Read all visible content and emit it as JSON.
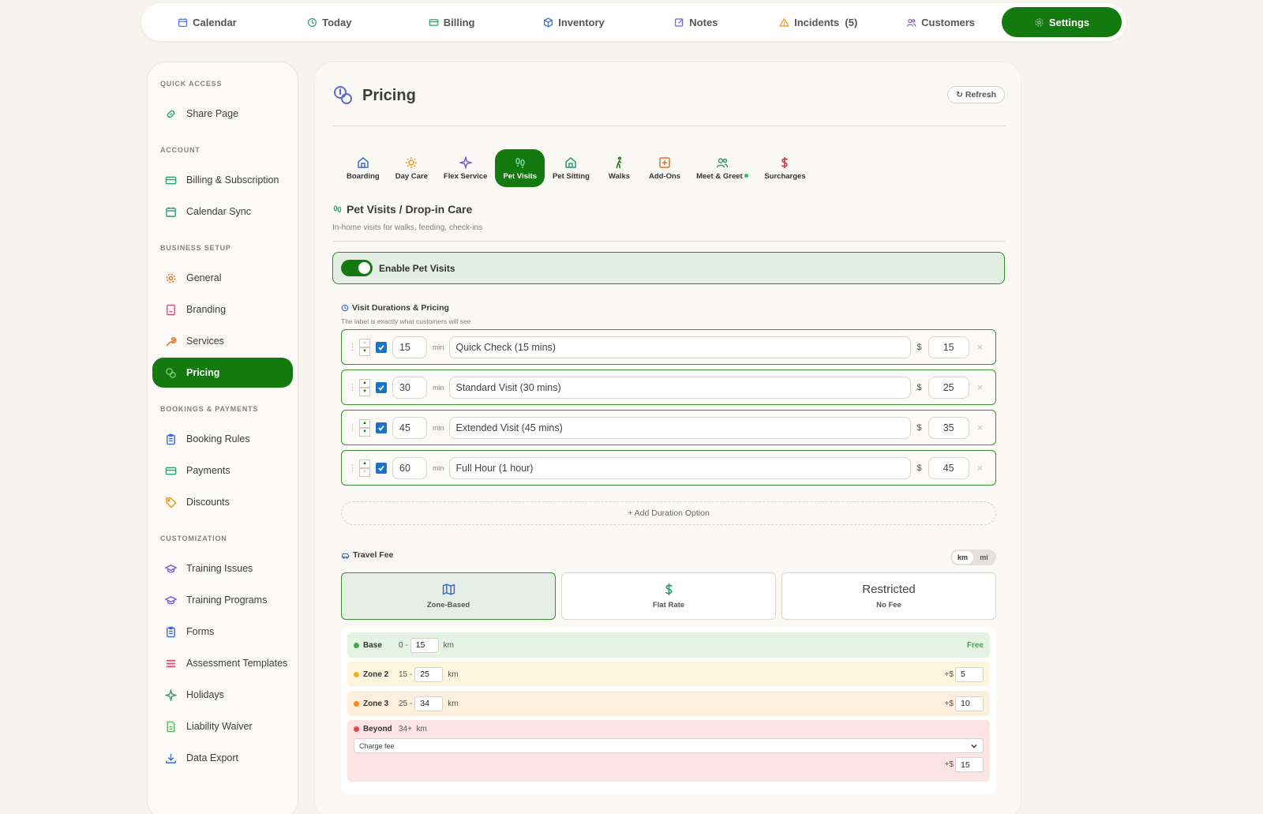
{
  "colors": {
    "accent": "#147a0f",
    "background": "#f7f3ee"
  },
  "topnav": [
    {
      "label": "Calendar",
      "icon": "calendar-icon",
      "color": "#4a7bd6"
    },
    {
      "label": "Today",
      "icon": "clock-icon",
      "color": "#2e9e6a"
    },
    {
      "label": "Billing",
      "icon": "credit-card-icon",
      "color": "#2e9e6a"
    },
    {
      "label": "Inventory",
      "icon": "box-icon",
      "color": "#3b6ad0"
    },
    {
      "label": "Notes",
      "icon": "edit-icon",
      "color": "#7b5bd0"
    },
    {
      "label": "Incidents  (5)",
      "icon": "warning-icon",
      "color": "#e89a1c"
    },
    {
      "label": "Customers",
      "icon": "users-icon",
      "color": "#8a62c9"
    },
    {
      "label": "Settings",
      "icon": "gear-icon",
      "color": "#ffffff",
      "active": true
    }
  ],
  "sidebar": {
    "quick_access": "QUICK ACCESS",
    "share_page": "Share Page",
    "account": "ACCOUNT",
    "billing_subscription": "Billing & Subscription",
    "calendar_sync": "Calendar Sync",
    "business_setup": "BUSINESS SETUP",
    "general": "General",
    "branding": "Branding",
    "services": "Services",
    "pricing": "Pricing",
    "bookings_payments": "BOOKINGS & PAYMENTS",
    "booking_rules": "Booking Rules",
    "payments": "Payments",
    "discounts": "Discounts",
    "customization": "CUSTOMIZATION",
    "training_issues": "Training Issues",
    "training_programs": "Training Programs",
    "forms": "Forms",
    "assessment_templates": "Assessment Templates",
    "holidays": "Holidays",
    "liability_waiver": "Liability Waiver",
    "data_export": "Data Export"
  },
  "main": {
    "title": "Pricing",
    "refresh_label": "↻ Refresh",
    "tabs": {
      "boarding": "Boarding",
      "day_care": "Day Care",
      "flex_service": "Flex Service",
      "pet_visits": "Pet Visits",
      "pet_sitting": "Pet Sitting",
      "walks": "Walks",
      "add_ons": "Add-Ons",
      "meet_greet": "Meet & Greet",
      "surcharges": "Surcharges"
    },
    "section_title": "Pet Visits / Drop-in Care",
    "section_subtitle": "In-home visits for walks, feeding, check-ins",
    "enable_label": "Enable Pet Visits",
    "durations_title": "Visit Durations & Pricing",
    "durations_note": "The label is exactly what customers will see",
    "min_unit": "min",
    "currency": "$",
    "durations": [
      {
        "minutes": "15",
        "label": "Quick Check (15 mins)",
        "price": "15"
      },
      {
        "minutes": "30",
        "label": "Standard Visit (30 mins)",
        "price": "25"
      },
      {
        "minutes": "45",
        "label": "Extended Visit (45 mins)",
        "price": "35"
      },
      {
        "minutes": "60",
        "label": "Full Hour (1 hour)",
        "price": "45"
      }
    ],
    "add_duration": "+ Add Duration Option",
    "travel_fee_title": "Travel Fee",
    "units": {
      "km": "km",
      "mi": "mi"
    },
    "fee_types": {
      "zone": "Zone-Based",
      "flat": "Flat Rate",
      "restricted_big": "Restricted",
      "restricted_small": "No Fee"
    },
    "zones": {
      "base_name": "Base",
      "base_from": "0 -",
      "base_to": "15",
      "base_unit": "km",
      "base_fee": "Free",
      "z2_name": "Zone 2",
      "z2_from": "15 -",
      "z2_to": "25",
      "z2_unit": "km",
      "z2_fee": "5",
      "z3_name": "Zone 3",
      "z3_from": "25 -",
      "z3_to": "34",
      "z3_unit": "km",
      "z3_fee": "10",
      "beyond_name": "Beyond",
      "beyond_range": "34+  km",
      "beyond_mode": "Charge fee",
      "beyond_fee": "15",
      "plus_dollar": "+$"
    }
  }
}
